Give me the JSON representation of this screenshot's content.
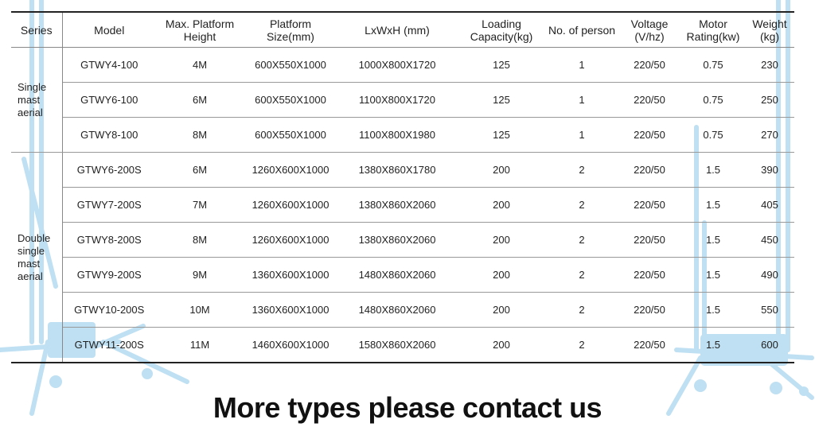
{
  "table": {
    "headers": [
      "Series",
      "Model",
      "Max. Platform Height",
      "Platform Size(mm)",
      "LxWxH (mm)",
      "Loading Capacity(kg)",
      "No. of person",
      "Voltage (V/hz)",
      "Motor Rating(kw)",
      "Weight (kg)"
    ],
    "groups": [
      {
        "series": "Single\nmast\naerial",
        "rows": [
          [
            "GTWY4-100",
            "4M",
            "600X550X1000",
            "1000X800X1720",
            "125",
            "1",
            "220/50",
            "0.75",
            "230"
          ],
          [
            "GTWY6-100",
            "6M",
            "600X550X1000",
            "1100X800X1720",
            "125",
            "1",
            "220/50",
            "0.75",
            "250"
          ],
          [
            "GTWY8-100",
            "8M",
            "600X550X1000",
            "1100X800X1980",
            "125",
            "1",
            "220/50",
            "0.75",
            "270"
          ]
        ]
      },
      {
        "series": "Double\nsingle\nmast\naerial",
        "rows": [
          [
            "GTWY6-200S",
            "6M",
            "1260X600X1000",
            "1380X860X1780",
            "200",
            "2",
            "220/50",
            "1.5",
            "390"
          ],
          [
            "GTWY7-200S",
            "7M",
            "1260X600X1000",
            "1380X860X2060",
            "200",
            "2",
            "220/50",
            "1.5",
            "405"
          ],
          [
            "GTWY8-200S",
            "8M",
            "1260X600X1000",
            "1380X860X2060",
            "200",
            "2",
            "220/50",
            "1.5",
            "450"
          ],
          [
            "GTWY9-200S",
            "9M",
            "1360X600X1000",
            "1480X860X2060",
            "200",
            "2",
            "220/50",
            "1.5",
            "490"
          ],
          [
            "GTWY10-200S",
            "10M",
            "1360X600X1000",
            "1480X860X2060",
            "200",
            "2",
            "220/50",
            "1.5",
            "550"
          ],
          [
            "GTWY11-200S",
            "11M",
            "1460X600X1000",
            "1580X860X2060",
            "200",
            "2",
            "220/50",
            "1.5",
            "600"
          ]
        ]
      }
    ]
  },
  "footer": "More types please contact us",
  "colors": {
    "watermark": "#bfe0f2",
    "border": "#222222"
  }
}
